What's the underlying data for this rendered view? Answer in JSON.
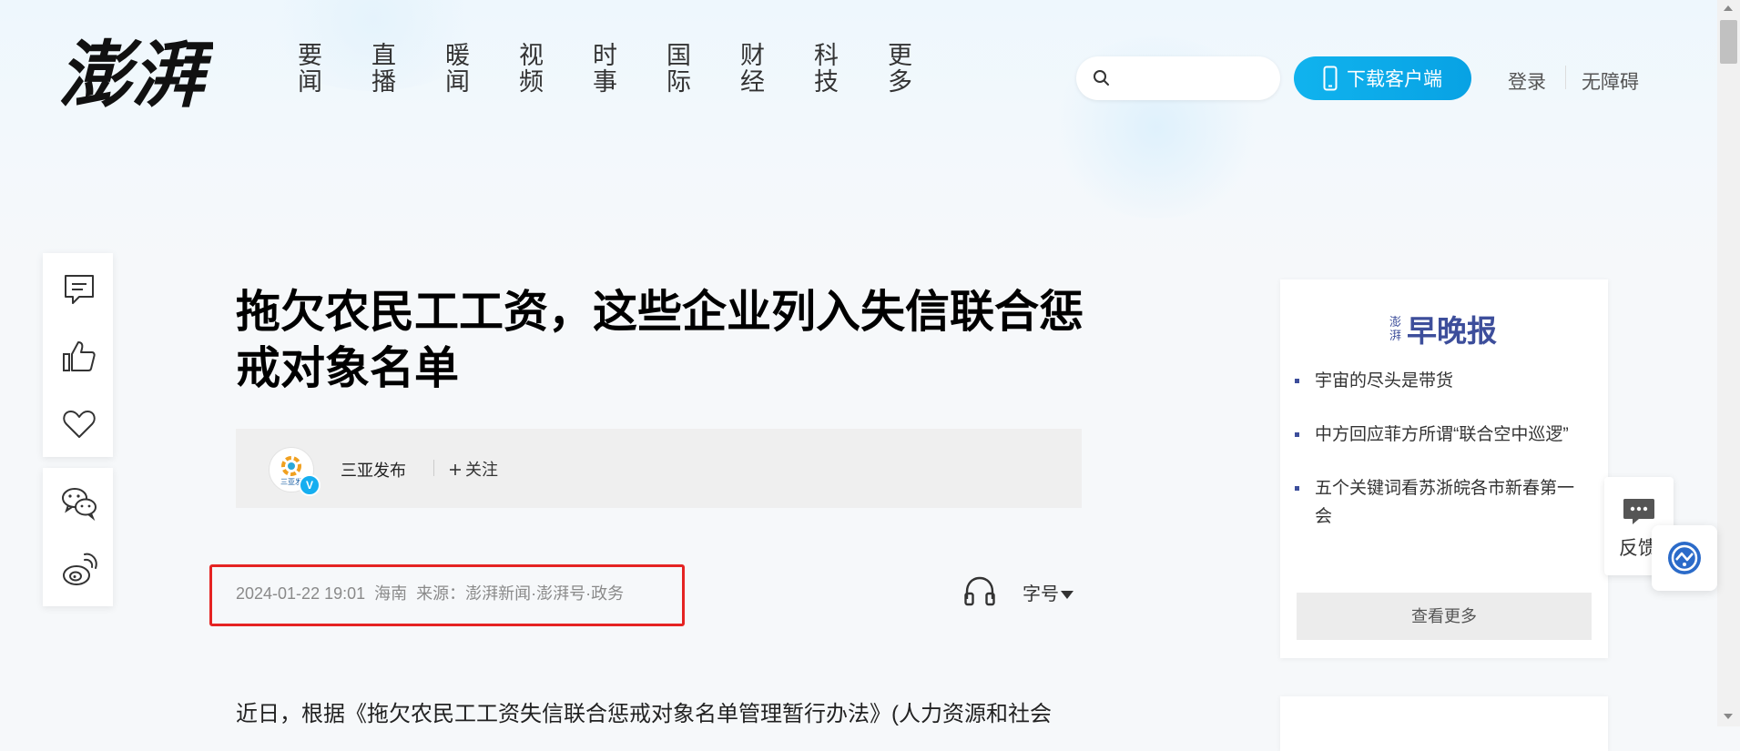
{
  "header": {
    "logo_text": "澎湃",
    "nav": [
      {
        "line1": "要",
        "line2": "闻"
      },
      {
        "line1": "直",
        "line2": "播"
      },
      {
        "line1": "暖",
        "line2": "闻"
      },
      {
        "line1": "视",
        "line2": "频"
      },
      {
        "line1": "时",
        "line2": "事"
      },
      {
        "line1": "国",
        "line2": "际"
      },
      {
        "line1": "财",
        "line2": "经"
      },
      {
        "line1": "科",
        "line2": "技"
      },
      {
        "line1": "更",
        "line2": "多"
      }
    ],
    "search": {
      "value": "",
      "placeholder": ""
    },
    "download_label": "下载客户端",
    "login_label": "登录",
    "accessibility_label": "无障碍"
  },
  "article": {
    "title": "拖欠农民工工资，这些企业列入失信联合惩戒对象名单",
    "author": {
      "name": "三亚发布",
      "avatar_text": "三亚发",
      "verified_mark": "V",
      "follow_label": "关注"
    },
    "meta": {
      "datetime": "2024-01-22 19:01",
      "location": "海南",
      "source": "来源：澎湃新闻·澎湃号·政务"
    },
    "font_size_label": "字号",
    "body_first_line": "近日，根据《拖欠农民工工资失信联合惩戒对象名单管理暂行办法》(人力资源和社会"
  },
  "side_panel": {
    "logo_small": "澎湃",
    "logo_big": "早晚报",
    "items": [
      "宇宙的尽头是带货",
      "中方回应菲方所谓“联合空中巡逻”",
      "五个关键词看苏浙皖各市新春第一会"
    ],
    "see_more_label": "查看更多"
  },
  "feedback_label": "反馈",
  "colors": {
    "accent": "#0ca9ea",
    "highlight_box": "#e52322",
    "panel_brand": "#3d4e9b"
  }
}
